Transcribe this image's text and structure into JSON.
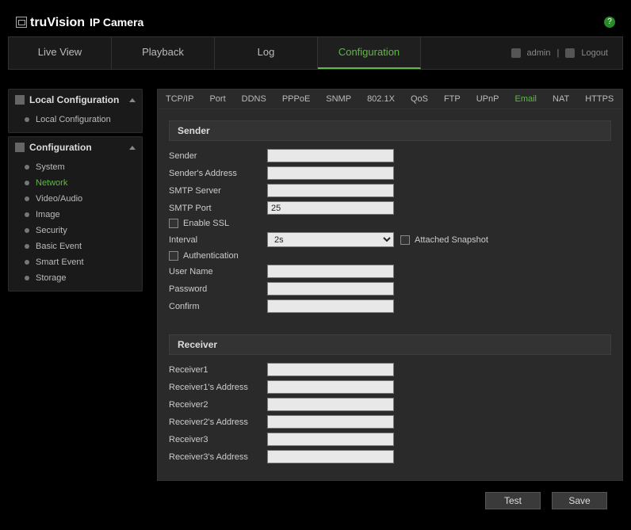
{
  "brand": {
    "text1": "truVision",
    "text2": "IP Camera"
  },
  "help_tooltip": "?",
  "main_tabs": [
    "Live View",
    "Playback",
    "Log",
    "Configuration"
  ],
  "main_tab_active": 3,
  "user": {
    "name": "admin",
    "sep": "|",
    "logout": "Logout"
  },
  "sidebar": {
    "sections": [
      {
        "title": "Local Configuration",
        "items": [
          "Local Configuration"
        ],
        "active": -1
      },
      {
        "title": "Configuration",
        "items": [
          "System",
          "Network",
          "Video/Audio",
          "Image",
          "Security",
          "Basic Event",
          "Smart Event",
          "Storage"
        ],
        "active": 1
      }
    ]
  },
  "subtabs": [
    "TCP/IP",
    "Port",
    "DDNS",
    "PPPoE",
    "SNMP",
    "802.1X",
    "QoS",
    "FTP",
    "UPnP",
    "Email",
    "NAT",
    "HTTPS"
  ],
  "subtab_active": 9,
  "groups": {
    "sender": "Sender",
    "receiver": "Receiver"
  },
  "fields": {
    "sender": "Sender",
    "sender_addr": "Sender's Address",
    "smtp_server": "SMTP Server",
    "smtp_port": "SMTP Port",
    "smtp_port_val": "25",
    "enable_ssl": "Enable SSL",
    "interval": "Interval",
    "interval_val": "2s",
    "attached_snapshot": "Attached Snapshot",
    "authentication": "Authentication",
    "user_name": "User Name",
    "password": "Password",
    "confirm": "Confirm",
    "receiver1": "Receiver1",
    "receiver1_addr": "Receiver1's Address",
    "receiver2": "Receiver2",
    "receiver2_addr": "Receiver2's Address",
    "receiver3": "Receiver3",
    "receiver3_addr": "Receiver3's Address"
  },
  "buttons": {
    "test": "Test",
    "save": "Save"
  }
}
